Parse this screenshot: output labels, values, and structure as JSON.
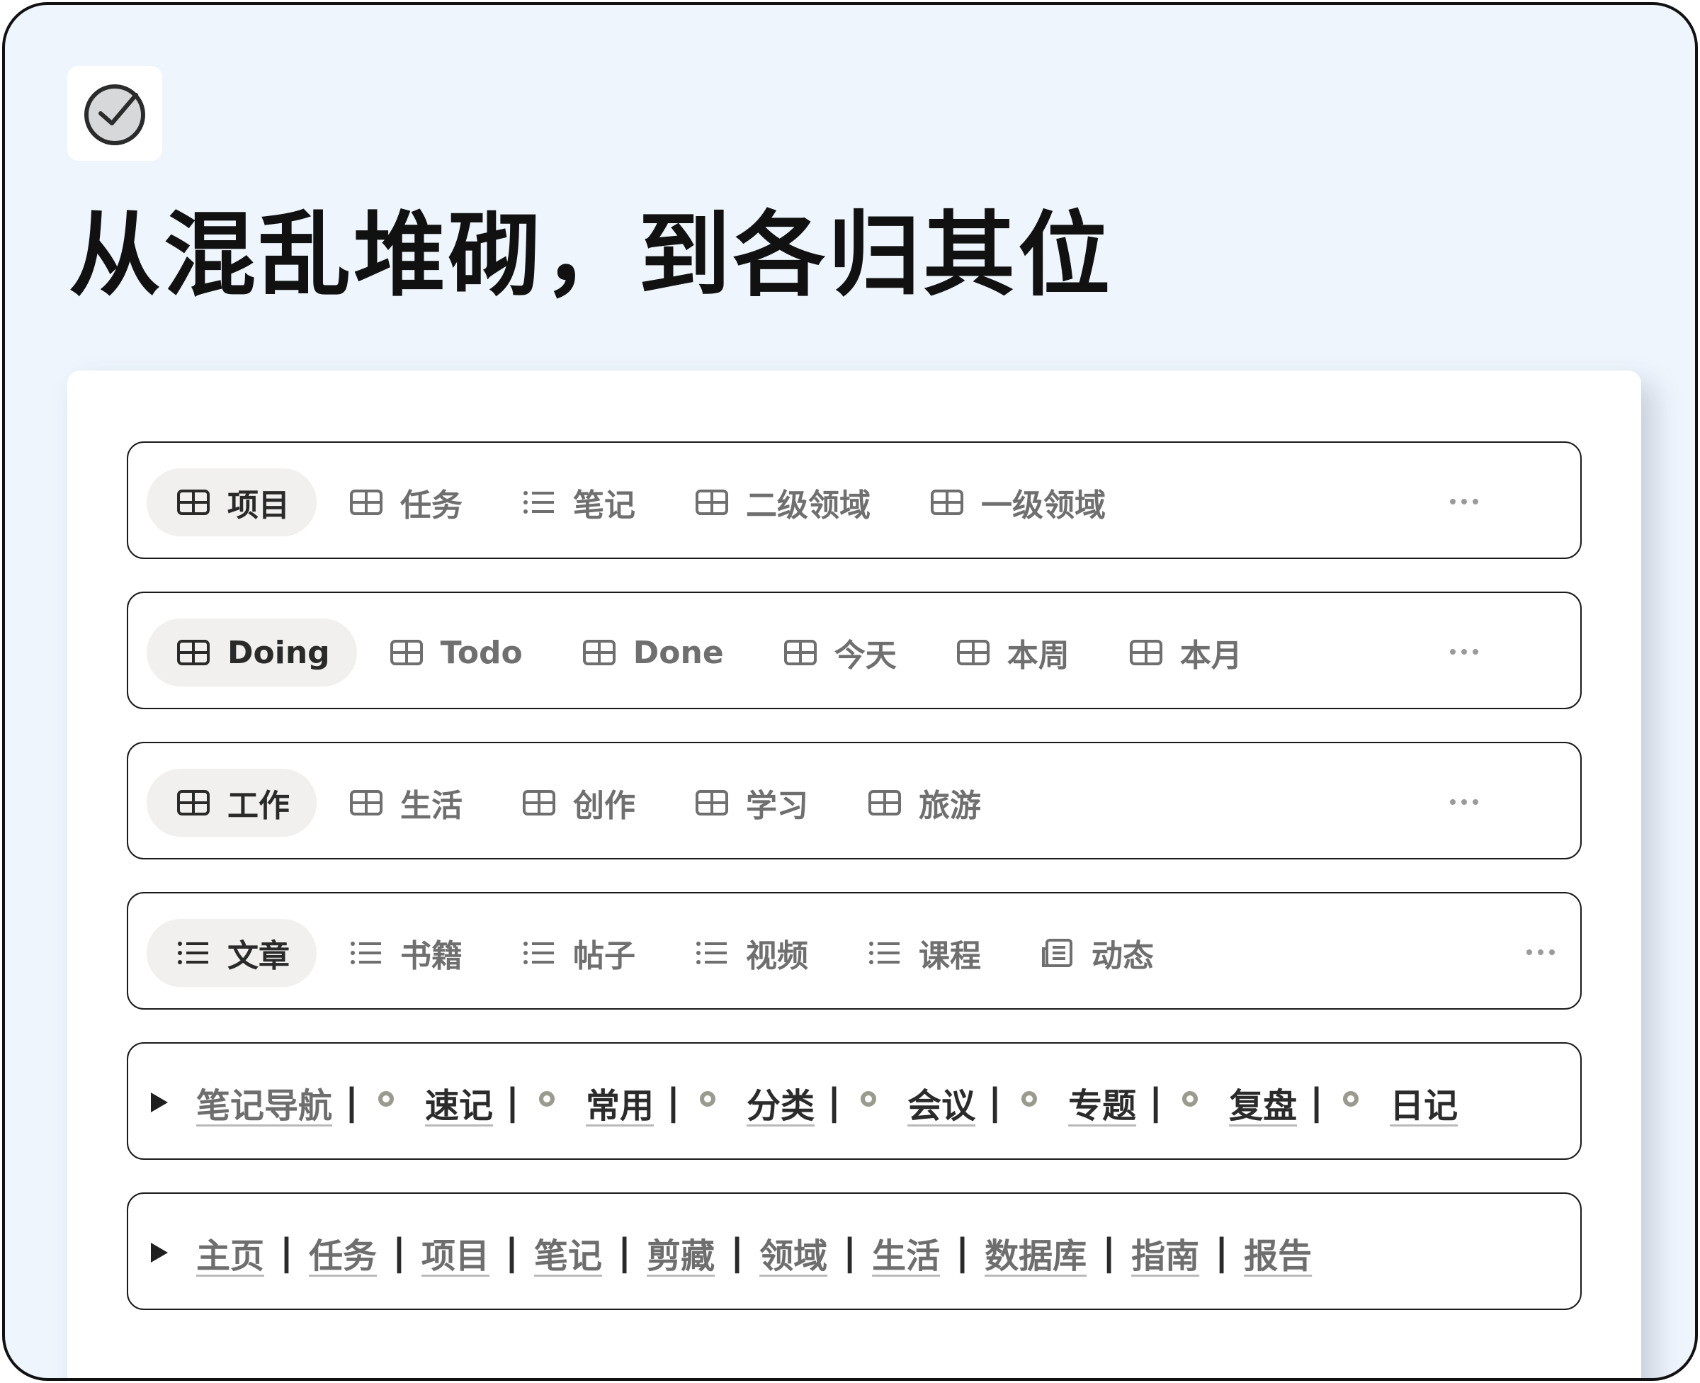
{
  "header": {
    "title": "从混乱堆砌，到各归其位"
  },
  "rows": [
    {
      "tabs": [
        {
          "label": "项目",
          "icon": "table-icon",
          "active": true
        },
        {
          "label": "任务",
          "icon": "table-icon"
        },
        {
          "label": "笔记",
          "icon": "list-icon"
        },
        {
          "label": "二级领域",
          "icon": "table-icon"
        },
        {
          "label": "一级领域",
          "icon": "table-icon"
        }
      ]
    },
    {
      "tabs": [
        {
          "label": "Doing",
          "icon": "table-icon",
          "active": true
        },
        {
          "label": "Todo",
          "icon": "table-icon"
        },
        {
          "label": "Done",
          "icon": "table-icon"
        },
        {
          "label": "今天",
          "icon": "table-icon"
        },
        {
          "label": "本周",
          "icon": "table-icon"
        },
        {
          "label": "本月",
          "icon": "table-icon"
        }
      ]
    },
    {
      "tabs": [
        {
          "label": "工作",
          "icon": "table-icon",
          "active": true
        },
        {
          "label": "生活",
          "icon": "table-icon"
        },
        {
          "label": "创作",
          "icon": "table-icon"
        },
        {
          "label": "学习",
          "icon": "table-icon"
        },
        {
          "label": "旅游",
          "icon": "table-icon"
        }
      ]
    },
    {
      "tabs": [
        {
          "label": "文章",
          "icon": "list-icon",
          "active": true
        },
        {
          "label": "书籍",
          "icon": "list-icon"
        },
        {
          "label": "帖子",
          "icon": "list-icon"
        },
        {
          "label": "视频",
          "icon": "list-icon"
        },
        {
          "label": "课程",
          "icon": "list-icon"
        },
        {
          "label": "动态",
          "icon": "feed-icon"
        }
      ]
    }
  ],
  "note_nav": {
    "title": "笔记导航",
    "separator": "|",
    "items": [
      "速记",
      "常用",
      "分类",
      "会议",
      "专题",
      "复盘",
      "日记"
    ]
  },
  "main_nav": {
    "separator": "|",
    "items": [
      "主页",
      "任务",
      "项目",
      "笔记",
      "剪藏",
      "领域",
      "生活",
      "数据库",
      "指南",
      "报告"
    ]
  },
  "colors": {
    "page_background": "#eef5fd",
    "card_background": "#ffffff",
    "active_tab": "#f1f0ee",
    "text_muted": "#6f6f6f",
    "border": "#1a1a1a"
  }
}
